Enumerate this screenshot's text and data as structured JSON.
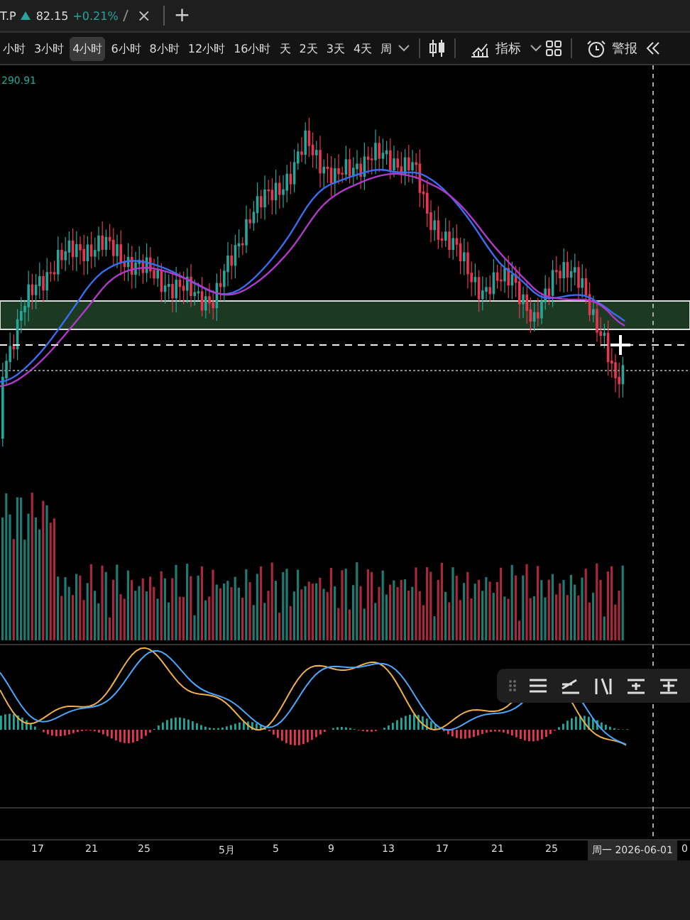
{
  "tab": {
    "symbol": "T.P",
    "price": "82.15",
    "change": "+0.21%",
    "close": "×",
    "add": "+"
  },
  "intervals": [
    {
      "label": "小时",
      "selected": false
    },
    {
      "label": "3小时",
      "selected": false
    },
    {
      "label": "4小时",
      "selected": true
    },
    {
      "label": "6小时",
      "selected": false
    },
    {
      "label": "8小时",
      "selected": false
    },
    {
      "label": "12小时",
      "selected": false
    },
    {
      "label": "16小时",
      "selected": false
    },
    {
      "label": "天",
      "selected": false
    },
    {
      "label": "2天",
      "selected": false
    },
    {
      "label": "3天",
      "selected": false
    },
    {
      "label": "4天",
      "selected": false
    },
    {
      "label": "周",
      "selected": false
    }
  ],
  "toolbar": {
    "indicators": "指标",
    "alert": "警报"
  },
  "chart": {
    "high_label": "290.91"
  },
  "x_axis": {
    "labels": [
      "17",
      "21",
      "25",
      "5月",
      "5",
      "9",
      "13",
      "17",
      "21",
      "25"
    ],
    "crosshair_label": "周一 2026-06-01",
    "cut_label": "0"
  }
}
